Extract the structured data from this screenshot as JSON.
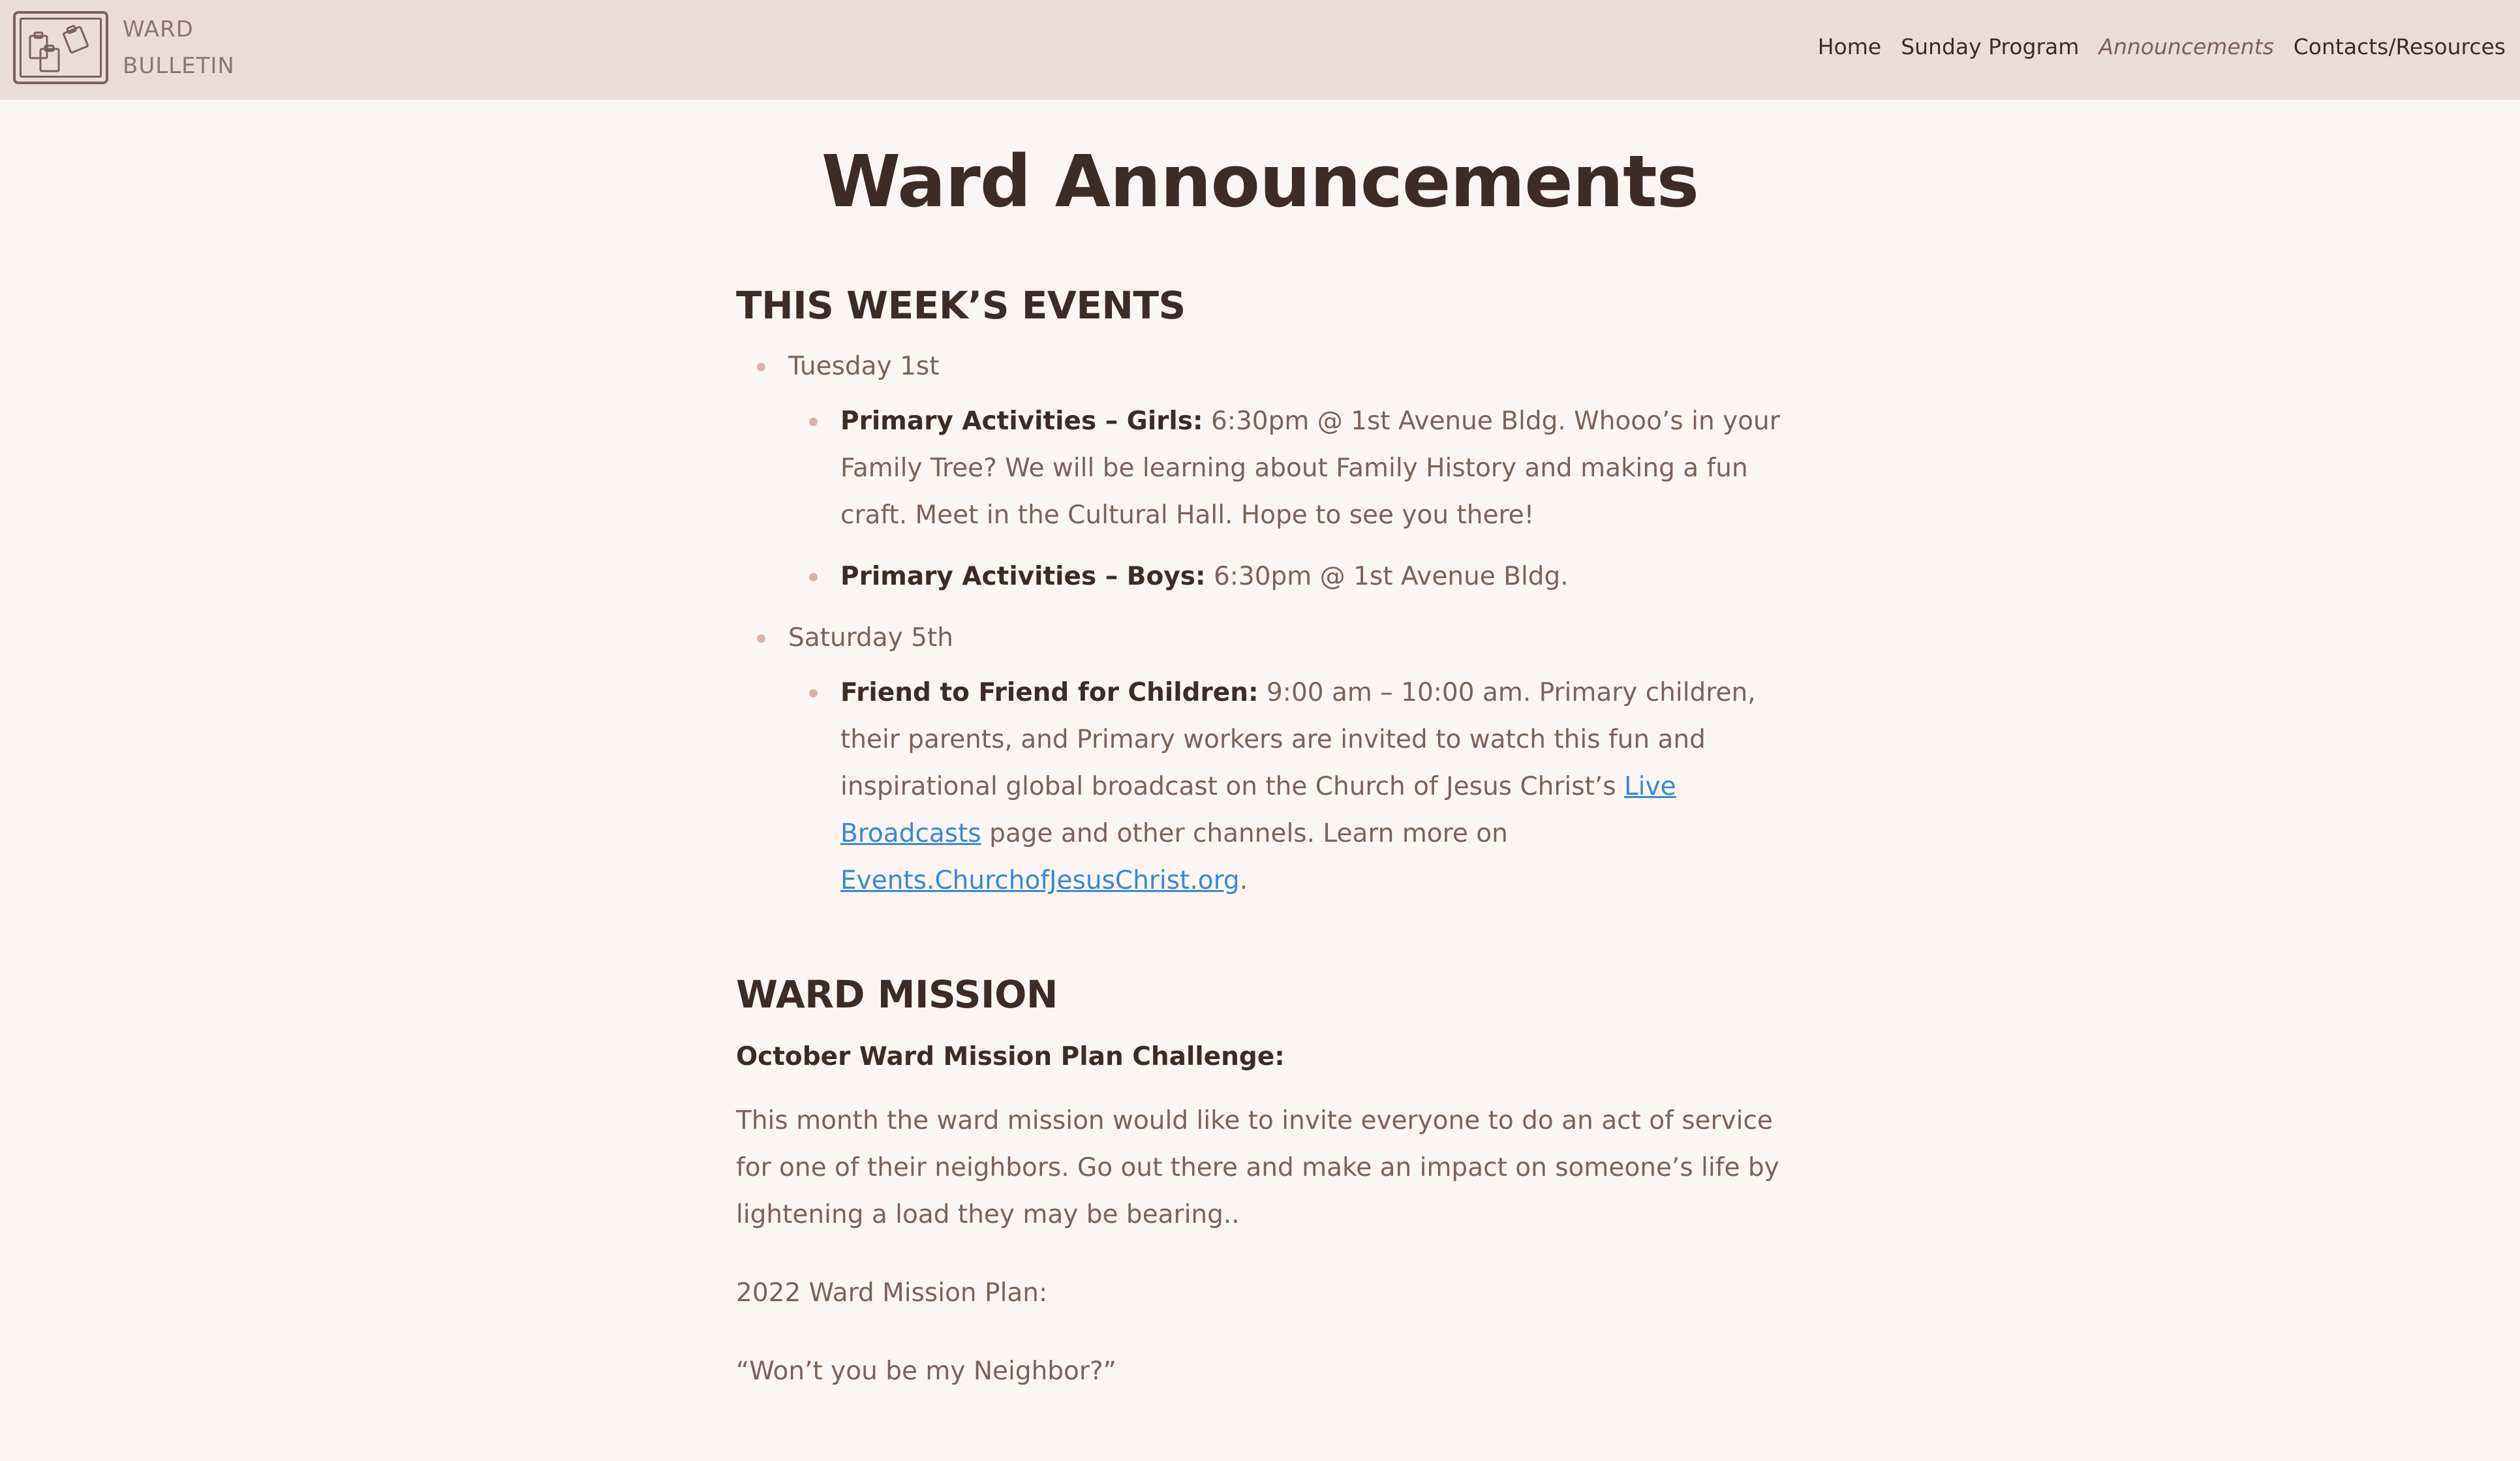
{
  "header": {
    "brand_line1": "WARD",
    "brand_line2": "BULLETIN",
    "nav": [
      {
        "label": "Home"
      },
      {
        "label": "Sunday Program"
      },
      {
        "label": "Announcements"
      },
      {
        "label": "Contacts/Resources"
      }
    ]
  },
  "page": {
    "title": "Ward Announcements"
  },
  "events_section": {
    "heading": "THIS WEEK’S EVENTS",
    "days": [
      {
        "label": "Tuesday 1st",
        "events": [
          {
            "title": "Primary Activities – Girls:",
            "text": " 6:30pm @ 1st Avenue Bldg. Whooo’s in your Family Tree? We will be learning about Family History and making a fun craft. Meet in the Cultural Hall. Hope to see you there!"
          },
          {
            "title": "Primary Activities – Boys:",
            "text": " 6:30pm @ 1st Avenue Bldg."
          }
        ]
      },
      {
        "label": "Saturday 5th",
        "events": [
          {
            "title": "Friend to Friend for Children:",
            "text_part1": " 9:00 am – 10:00 am. Primary children, their parents, and Primary workers are invited to watch this fun and inspirational global broadcast on the Church of Jesus Christ’s ",
            "link1": "Live Broadcasts",
            "text_part2": " page and other channels. Learn more on ",
            "link2": "Events.ChurchofJesusChrist.org",
            "text_part3": "."
          }
        ]
      }
    ]
  },
  "mission_section": {
    "heading": "WARD MISSION",
    "subheading": "October Ward Mission Plan Challenge:",
    "paragraph1": "This month the ward mission would like to invite everyone to do an act of service for one of their neighbors. Go out there and make an impact on someone’s life by lightening a load they may be bearing..",
    "paragraph2": "2022 Ward Mission Plan:",
    "paragraph3": "“Won’t you be my Neighbor?”"
  },
  "colors": {
    "header_bg": "#eaddd8",
    "page_bg": "#fbf6f4",
    "heading": "#3d2b25",
    "body_text": "#7b6259",
    "link": "#3a86d8",
    "bullet": "#d8b4a8"
  },
  "icons": {
    "brand_logo": "bulletin-board-icon"
  }
}
